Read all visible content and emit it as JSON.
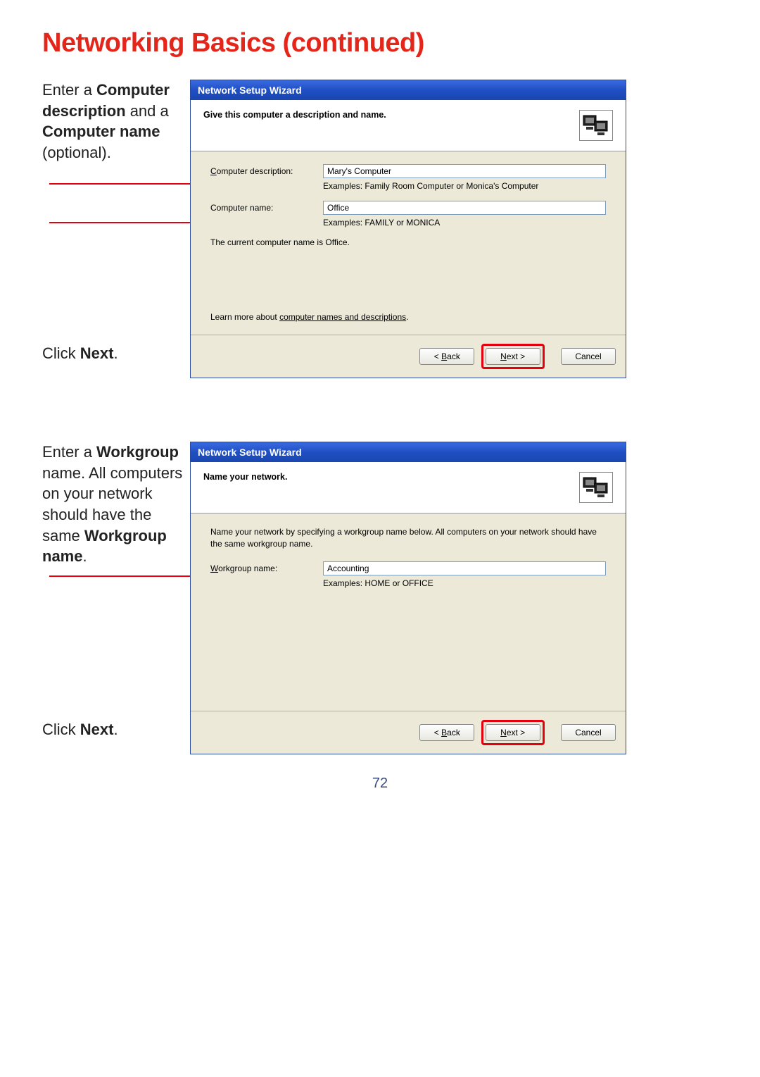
{
  "page": {
    "title": "Networking Basics (continued)",
    "number": "72"
  },
  "section1": {
    "side_segments": [
      "Enter a ",
      "Computer description",
      " and a ",
      "Computer name",
      " (optional)."
    ],
    "bottom_segments": [
      "Click ",
      "Next",
      "."
    ],
    "dialog": {
      "title": "Network Setup Wizard",
      "header": "Give this computer a description and name.",
      "desc_label_pre": "C",
      "desc_label_post": "omputer description:",
      "desc_value": "Mary's Computer",
      "desc_hint": "Examples: Family Room Computer or Monica's Computer",
      "name_label": "Computer name:",
      "name_value": "Office",
      "name_hint": "Examples: FAMILY or MONICA",
      "current": "The current computer name is Office.",
      "learn_pre": "Learn more about ",
      "learn_link": "computer names and descriptions",
      "learn_post": ".",
      "back_pre": "< ",
      "back_u": "B",
      "back_post": "ack",
      "next_u": "N",
      "next_post": "ext >",
      "cancel": "Cancel"
    }
  },
  "section2": {
    "side_segments": [
      "Enter a ",
      "Workgroup",
      " name.  All computers on your network should have the same ",
      "Workgroup name",
      "."
    ],
    "bottom_segments": [
      "Click ",
      "Next",
      "."
    ],
    "dialog": {
      "title": "Network Setup Wizard",
      "header": "Name your network.",
      "intro": "Name your network by specifying a workgroup name below. All computers on your network should have the same workgroup name.",
      "wg_label_pre": "W",
      "wg_label_post": "orkgroup name:",
      "wg_value": "Accounting",
      "wg_hint": "Examples: HOME or OFFICE",
      "back_pre": "< ",
      "back_u": "B",
      "back_post": "ack",
      "next_u": "N",
      "next_post": "ext >",
      "cancel": "Cancel"
    }
  }
}
